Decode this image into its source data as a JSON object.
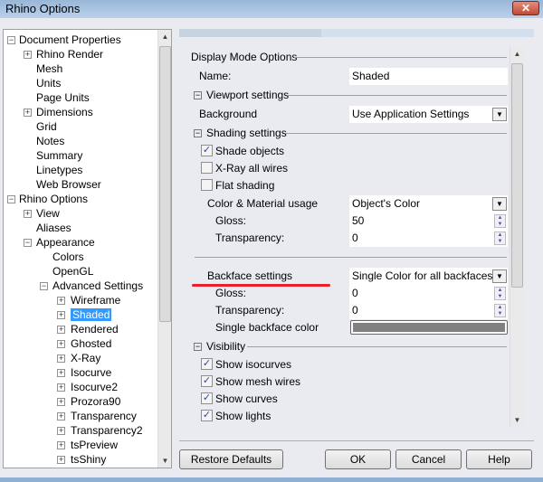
{
  "window": {
    "title": "Rhino Options"
  },
  "tree": [
    {
      "label": "Document Properties",
      "level": 0,
      "box": "minus"
    },
    {
      "label": "Rhino Render",
      "level": 1,
      "box": "plus"
    },
    {
      "label": "Mesh",
      "level": 1,
      "box": ""
    },
    {
      "label": "Units",
      "level": 1,
      "box": ""
    },
    {
      "label": "Page Units",
      "level": 1,
      "box": ""
    },
    {
      "label": "Dimensions",
      "level": 1,
      "box": "plus"
    },
    {
      "label": "Grid",
      "level": 1,
      "box": ""
    },
    {
      "label": "Notes",
      "level": 1,
      "box": ""
    },
    {
      "label": "Summary",
      "level": 1,
      "box": ""
    },
    {
      "label": "Linetypes",
      "level": 1,
      "box": ""
    },
    {
      "label": "Web Browser",
      "level": 1,
      "box": ""
    },
    {
      "label": "Rhino Options",
      "level": 0,
      "box": "minus"
    },
    {
      "label": "View",
      "level": 1,
      "box": "plus"
    },
    {
      "label": "Aliases",
      "level": 1,
      "box": ""
    },
    {
      "label": "Appearance",
      "level": 1,
      "box": "minus"
    },
    {
      "label": "Colors",
      "level": 2,
      "box": ""
    },
    {
      "label": "OpenGL",
      "level": 2,
      "box": ""
    },
    {
      "label": "Advanced Settings",
      "level": 2,
      "box": "minus"
    },
    {
      "label": "Wireframe",
      "level": 3,
      "box": "plus"
    },
    {
      "label": "Shaded",
      "level": 3,
      "box": "plus",
      "selected": true
    },
    {
      "label": "Rendered",
      "level": 3,
      "box": "plus"
    },
    {
      "label": "Ghosted",
      "level": 3,
      "box": "plus"
    },
    {
      "label": "X-Ray",
      "level": 3,
      "box": "plus"
    },
    {
      "label": "Isocurve",
      "level": 3,
      "box": "plus"
    },
    {
      "label": "Isocurve2",
      "level": 3,
      "box": "plus"
    },
    {
      "label": "Prozora90",
      "level": 3,
      "box": "plus"
    },
    {
      "label": "Transparency",
      "level": 3,
      "box": "plus"
    },
    {
      "label": "Transparency2",
      "level": 3,
      "box": "plus"
    },
    {
      "label": "tsPreview",
      "level": 3,
      "box": "plus"
    },
    {
      "label": "tsShiny",
      "level": 3,
      "box": "plus"
    }
  ],
  "options": {
    "display_mode": "Display Mode Options",
    "name_label": "Name:",
    "name_value": "Shaded",
    "viewport": "Viewport settings",
    "background_label": "Background",
    "background_value": "Use Application Settings",
    "shading": "Shading settings",
    "shade_objects": {
      "label": "Shade objects",
      "checked": true
    },
    "xray": {
      "label": "X-Ray all wires",
      "checked": false
    },
    "flat": {
      "label": "Flat shading",
      "checked": false
    },
    "color_usage_label": "Color & Material usage",
    "color_usage_value": "Object's Color",
    "gloss_label": "Gloss:",
    "gloss_value": "50",
    "transparency_label": "Transparency:",
    "transparency_value": "0",
    "backface_label": "Backface settings",
    "backface_value": "Single Color for all backfaces",
    "bf_gloss_label": "Gloss:",
    "bf_gloss_value": "0",
    "bf_transparency_label": "Transparency:",
    "bf_transparency_value": "0",
    "bf_color_label": "Single backface color",
    "bf_color": "#808080",
    "visibility": "Visibility",
    "show_isocurves": {
      "label": "Show isocurves",
      "checked": true
    },
    "show_mesh_wires": {
      "label": "Show mesh wires",
      "checked": true
    },
    "show_curves": {
      "label": "Show curves",
      "checked": true
    },
    "show_lights": {
      "label": "Show lights",
      "checked": true
    }
  },
  "buttons": {
    "restore": "Restore Defaults",
    "ok": "OK",
    "cancel": "Cancel",
    "help": "Help"
  },
  "colors": {
    "highlight": "#3399ff",
    "annotation": "#e8202a"
  }
}
